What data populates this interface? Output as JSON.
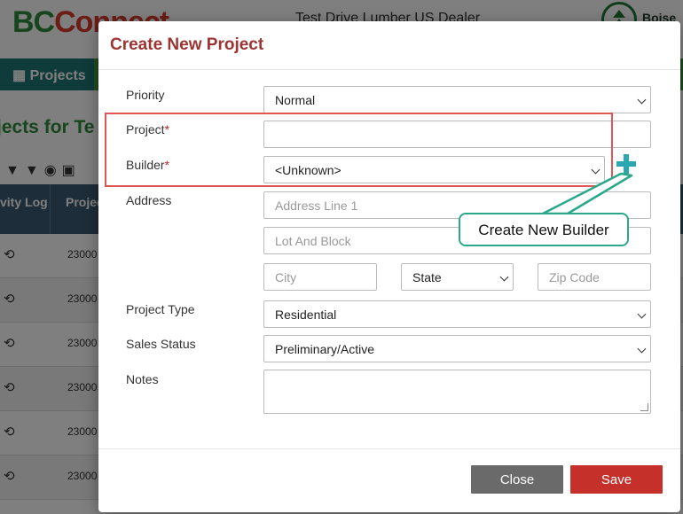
{
  "background": {
    "logo": {
      "part1": "BC",
      "part2": "Connect"
    },
    "dealer_name": "Test Drive Lumber US Dealer",
    "brand": "Boise",
    "nav_tab": "Projects",
    "section_title": "jects for Te",
    "grid_headers": {
      "col1": "vity Log",
      "col2": "Projec"
    },
    "rows": [
      "23000",
      "23000",
      "23000",
      "23000",
      "23000",
      "23000"
    ]
  },
  "modal": {
    "title": "Create New Project",
    "labels": {
      "priority": "Priority",
      "project": "Project",
      "builder": "Builder",
      "address": "Address",
      "project_type": "Project Type",
      "sales_status": "Sales Status",
      "notes": "Notes",
      "required_mark": "*"
    },
    "fields": {
      "priority_value": "Normal",
      "project_value": "",
      "builder_value": "<Unknown>",
      "address1_placeholder": "Address Line 1",
      "lot_placeholder": "Lot And Block",
      "city_placeholder": "City",
      "state_value": "State",
      "zip_placeholder": "Zip Code",
      "project_type_value": "Residential",
      "sales_status_value": "Preliminary/Active",
      "notes_value": ""
    },
    "buttons": {
      "close": "Close",
      "save": "Save"
    }
  },
  "annotation": {
    "callout": "Create New Builder"
  },
  "colors": {
    "title": "#9c3432",
    "save": "#c5302a",
    "close": "#6a6a6a",
    "highlight": "#e15555",
    "callout_border": "#2aa88a",
    "plus": "#2aa8b2"
  },
  "icons": [
    "history-icon",
    "filter-icon",
    "eye-icon",
    "save-icon",
    "plus-icon",
    "chevron-down-icon"
  ]
}
